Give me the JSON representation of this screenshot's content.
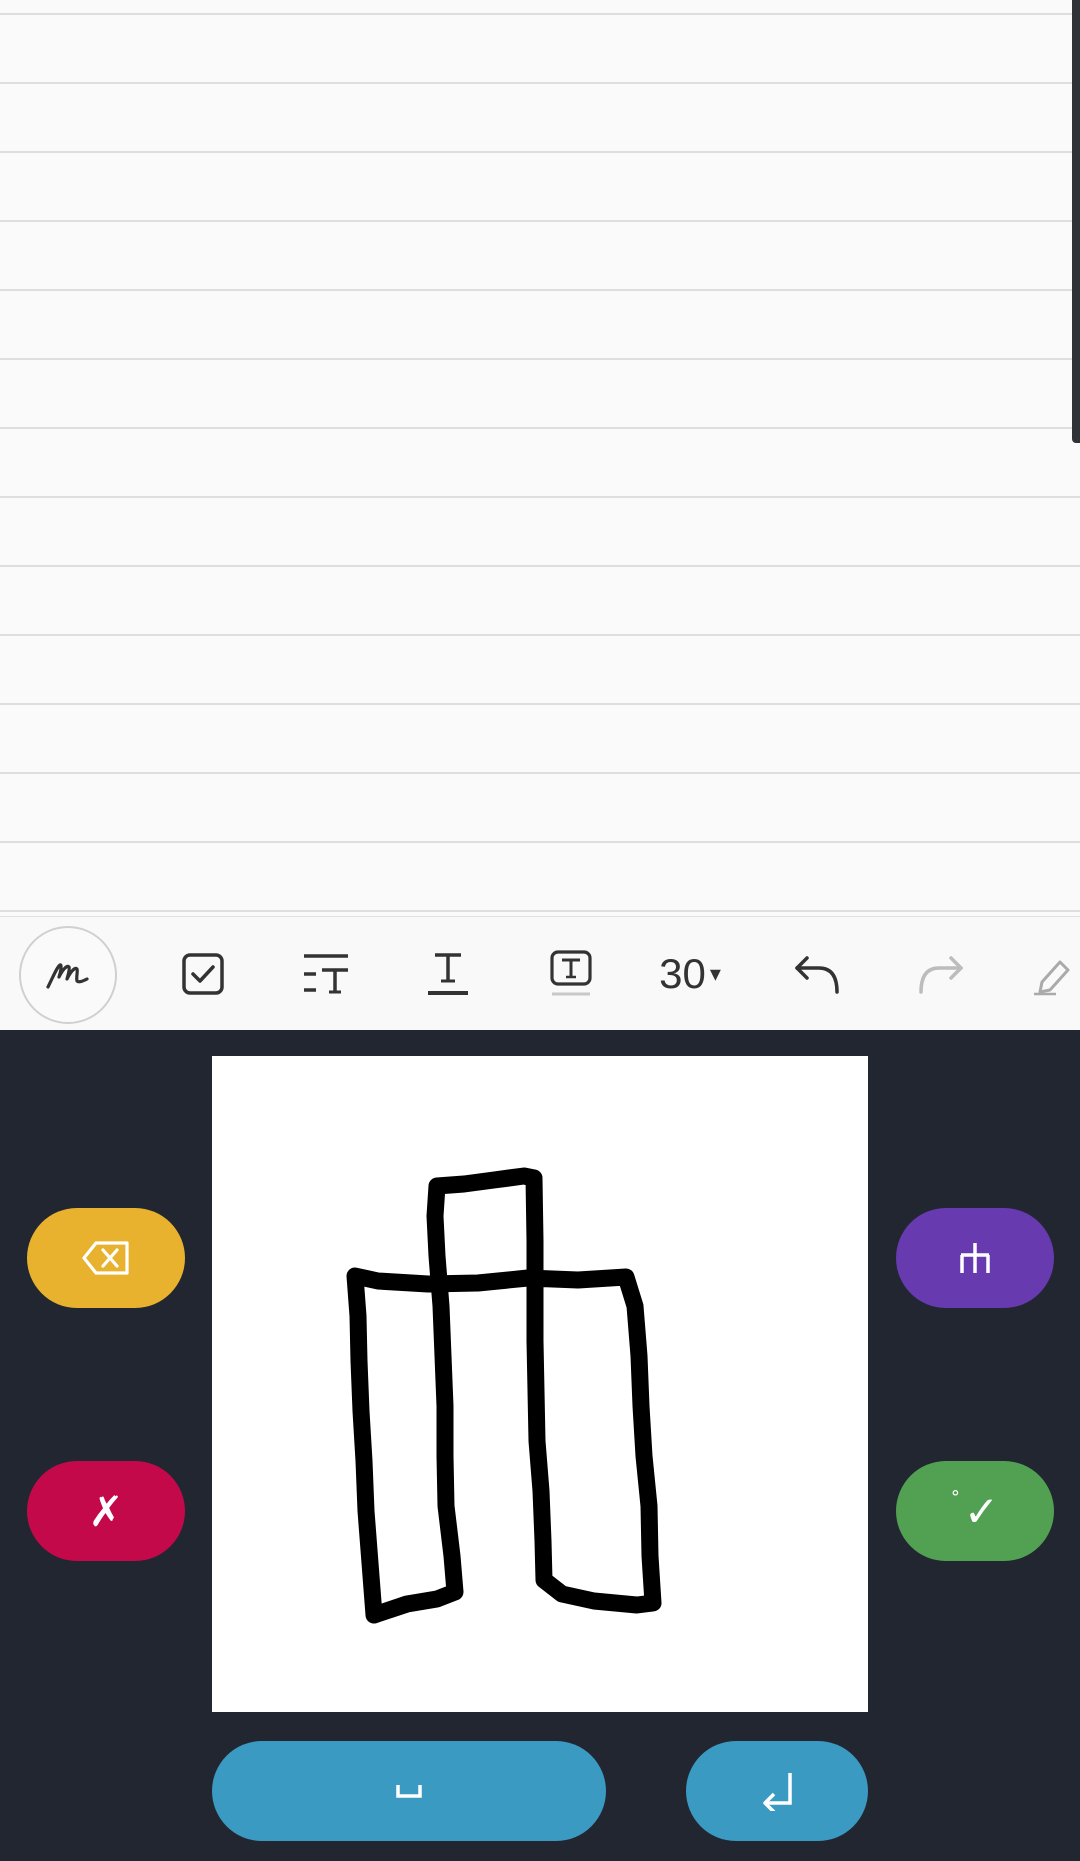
{
  "note": {
    "lines": "ruled"
  },
  "toolbar": {
    "font_size": "30",
    "font_size_caret": "▾",
    "tools": [
      {
        "name": "pen",
        "icon": "handwriting-pen-icon",
        "selected": true
      },
      {
        "name": "checkbox",
        "icon": "checkbox-icon"
      },
      {
        "name": "align",
        "icon": "text-align-icon"
      },
      {
        "name": "underline",
        "icon": "text-underline-icon"
      },
      {
        "name": "textbox",
        "icon": "text-box-icon"
      },
      {
        "name": "undo",
        "icon": "undo-icon"
      },
      {
        "name": "redo",
        "icon": "redo-icon",
        "disabled": true
      },
      {
        "name": "more",
        "icon": "eraser-pen-icon"
      }
    ]
  },
  "handwriting": {
    "colors": {
      "panel": "#212631",
      "backspace": "#e8b22f",
      "cancel": "#c4094b",
      "convert": "#673ab0",
      "accept": "#52a152",
      "space": "#3a9ac2",
      "enter": "#3a9ac2"
    },
    "backspace_icon": "backspace-icon",
    "cancel_glyph": "✗",
    "convert_glyph": "ᅲ",
    "accept_glyph": "✓",
    "accept_degree": "°",
    "space_glyph": "␣",
    "enter_glyph": "↲"
  }
}
